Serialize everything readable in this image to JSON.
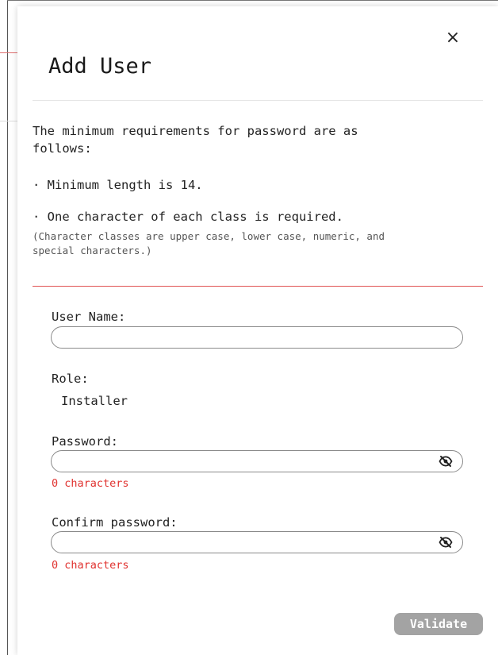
{
  "dialog": {
    "title": "Add User",
    "close_label": "×"
  },
  "requirements": {
    "intro_line1": "The minimum requirements for password are as",
    "intro_line2": "follows:",
    "rule_length": "· Minimum length is 14.",
    "rule_classes": "· One character of each class is required.",
    "note_line1": "(Character classes are upper case, lower case, numeric, and",
    "note_line2": "special characters.)"
  },
  "form": {
    "username": {
      "label": "User Name:",
      "value": ""
    },
    "role": {
      "label": "Role:",
      "value": "Installer"
    },
    "password": {
      "label": "Password:",
      "value": "",
      "count_text": "0 characters",
      "icon": "eye-slash-icon"
    },
    "confirm_password": {
      "label": "Confirm password:",
      "value": "",
      "count_text": "0 characters",
      "icon": "eye-slash-icon"
    },
    "validate_label": "Validate"
  },
  "colors": {
    "error_red": "#e0312e",
    "divider_red": "#e05252",
    "button_disabled": "#a3a3a3"
  }
}
